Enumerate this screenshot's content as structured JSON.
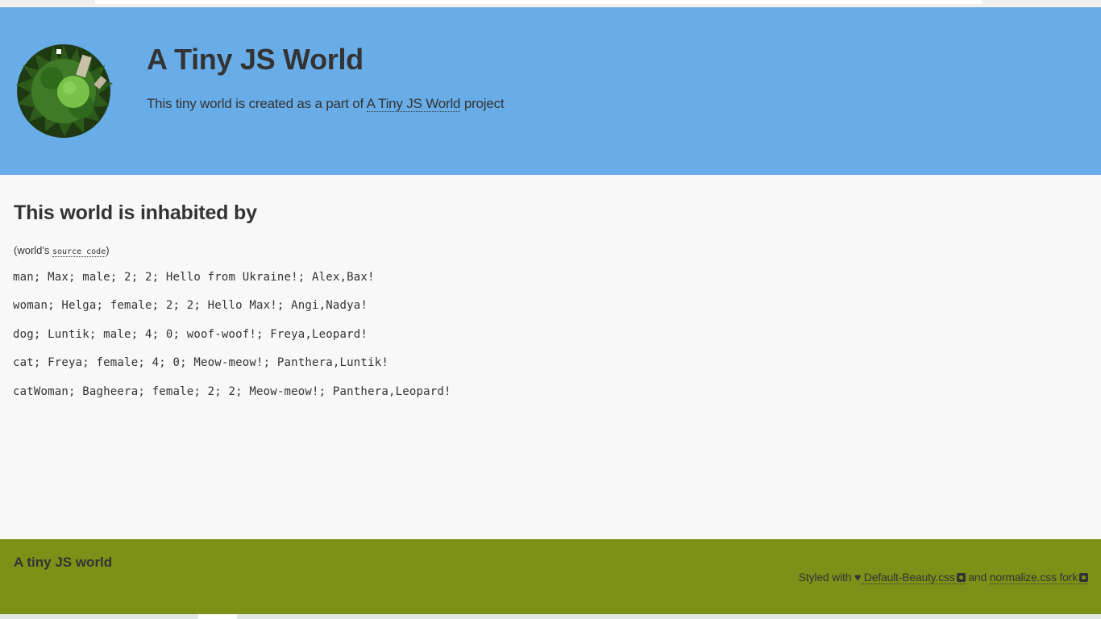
{
  "header": {
    "title": "A Tiny JS World",
    "tagline_before": "This tiny world is created as a part of ",
    "tagline_link": "A Tiny JS World",
    "tagline_after": " project",
    "logo_icon": "tiny-planet-icon"
  },
  "main": {
    "heading": "This world is inhabited by",
    "note_before": "(world's ",
    "note_link": "source code",
    "note_after": ")",
    "inhabitants": [
      "man; Max; male; 2; 2; Hello from Ukraine!; Alex,Bax!",
      "woman; Helga; female; 2; 2; Hello Max!; Angi,Nadya!",
      "dog; Luntik; male; 4; 0; woof-woof!; Freya,Leopard!",
      "cat; Freya; female; 4; 0; Meow-meow!; Panthera,Luntik!",
      "catWoman; Bagheera; female; 2; 2; Meow-meow!; Panthera,Leopard!"
    ]
  },
  "footer": {
    "title": "A tiny JS world",
    "credits_before": "Styled with ",
    "credits_link1": " Default-Beauty.css",
    "credits_and": " and ",
    "credits_link2": "normalize.css fork",
    "heart_icon": "heart-icon",
    "github_icon": "github-icon"
  },
  "colors": {
    "header_bg": "#69ade8",
    "footer_bg": "#7d9118",
    "page_bg": "#f8f8f8"
  }
}
